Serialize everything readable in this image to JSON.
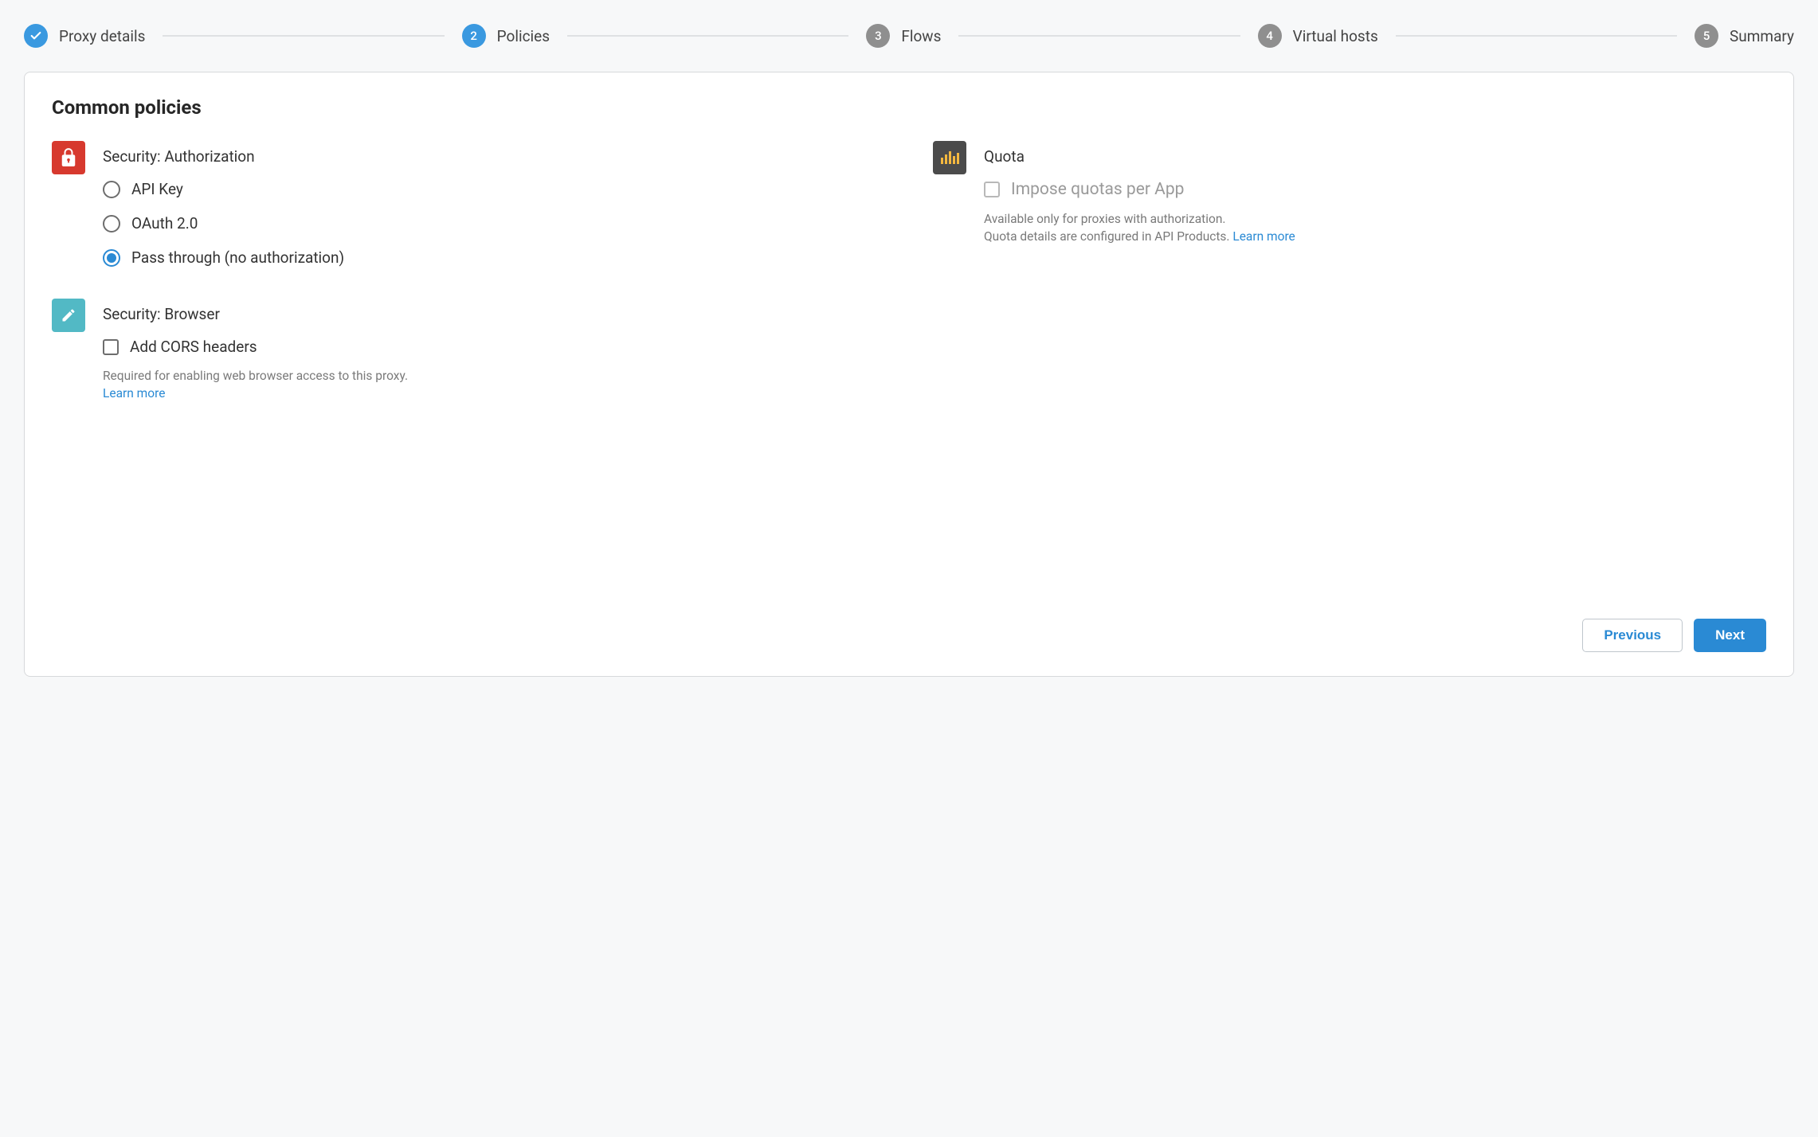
{
  "stepper": {
    "steps": [
      {
        "num": "",
        "label": "Proxy details",
        "state": "done"
      },
      {
        "num": "2",
        "label": "Policies",
        "state": "active"
      },
      {
        "num": "3",
        "label": "Flows",
        "state": "pending"
      },
      {
        "num": "4",
        "label": "Virtual hosts",
        "state": "pending"
      },
      {
        "num": "5",
        "label": "Summary",
        "state": "pending"
      }
    ]
  },
  "page": {
    "title": "Common policies"
  },
  "security_auth": {
    "title": "Security: Authorization",
    "options": {
      "api_key": "API Key",
      "oauth": "OAuth 2.0",
      "pass_through": "Pass through (no authorization)"
    },
    "selected": "pass_through"
  },
  "quota": {
    "title": "Quota",
    "checkbox_label": "Impose quotas per App",
    "helper_line1": "Available only for proxies with authorization.",
    "helper_line2": "Quota details are configured in API Products. ",
    "learn_more": "Learn more"
  },
  "security_browser": {
    "title": "Security: Browser",
    "checkbox_label": "Add CORS headers",
    "helper": "Required for enabling web browser access to this proxy.",
    "learn_more": "Learn more"
  },
  "buttons": {
    "previous": "Previous",
    "next": "Next"
  }
}
